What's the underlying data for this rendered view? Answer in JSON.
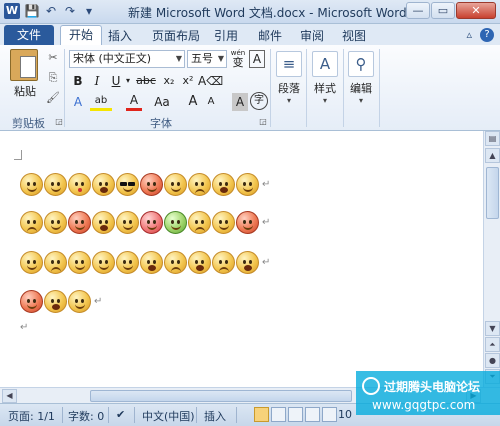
{
  "window": {
    "title": "新建 Microsoft Word 文档.docx - Microsoft Word",
    "app_icon": "W",
    "controls": {
      "minimize": "—",
      "maximize": "▭",
      "close": "✕"
    }
  },
  "qat": {
    "save_icon": "💾",
    "undo_icon": "↶",
    "redo_icon": "↷",
    "customize_icon": "▾"
  },
  "tabs": {
    "file": "文件",
    "items": [
      "开始",
      "插入",
      "页面布局",
      "引用",
      "邮件",
      "审阅",
      "视图"
    ],
    "active": "开始",
    "help_icon": "?",
    "caret_icon": "▵"
  },
  "ribbon": {
    "clipboard": {
      "paste_label": "粘贴",
      "group_label": "剪贴板"
    },
    "font": {
      "font_name": "宋体 (中文正文)",
      "font_size": "五号",
      "wen_label": "wén",
      "wen_char": "变",
      "border_a": "A",
      "bold": "B",
      "italic": "I",
      "underline": "U",
      "strike": "abc",
      "subscript": "x₂",
      "superscript": "x²",
      "text_effect": "A",
      "highlight": "ab",
      "font_color": "A",
      "change_case": "Aa",
      "grow": "A",
      "shrink": "A",
      "char_shading": "A",
      "enclose": "字",
      "group_label": "字体"
    },
    "paragraph": {
      "label": "段落"
    },
    "styles": {
      "label": "样式"
    },
    "editing": {
      "label": "编辑"
    }
  },
  "document": {
    "para_mark": "↵",
    "end_mark": "↵"
  },
  "status": {
    "page": "页面: 1/1",
    "words": "字数: 0",
    "language": "中文(中国)",
    "mode": "插入",
    "zoom": "10"
  },
  "watermark": {
    "line1": "过期腾头电脑论坛",
    "line2": "www.gqgtpc.com"
  }
}
